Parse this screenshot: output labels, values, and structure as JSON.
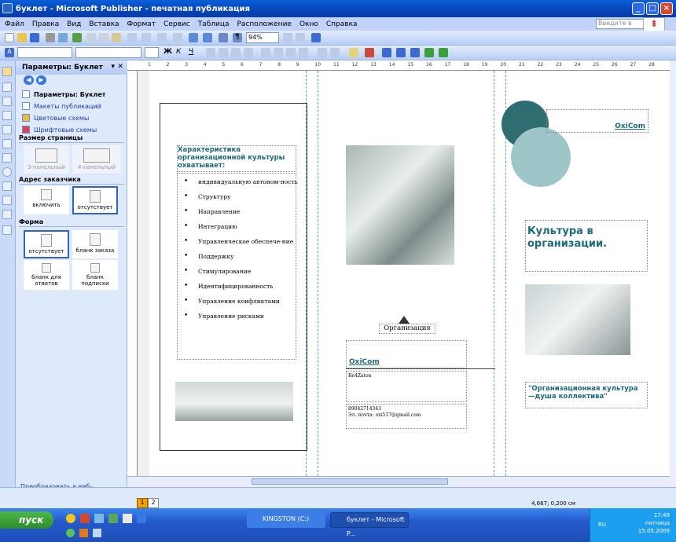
{
  "window": {
    "title": "буклет - Microsoft Publisher - печатная публикация"
  },
  "menu": [
    "Файл",
    "Правка",
    "Вид",
    "Вставка",
    "Формат",
    "Сервис",
    "Таблица",
    "Расположение",
    "Окно",
    "Справка"
  ],
  "help_placeholder": "Введите в",
  "toolbar": {
    "zoom": "94%"
  },
  "pane": {
    "title": "Параметры: Буклет",
    "links": [
      "Параметры: Буклет",
      "Макеты публикаций",
      "Цветовые схемы",
      "Шрифтовые схемы"
    ],
    "page_size_label": "Размер страницы",
    "page_sizes": [
      "3-панельный",
      "4-панельный"
    ],
    "address_label": "Адрес заказчика",
    "address_opts": [
      "включить",
      "отсутствует"
    ],
    "form_label": "Форма",
    "form_opts": [
      "отсутствует",
      "бланк заказа",
      "бланк для ответов",
      "бланк подписки"
    ],
    "convert_link": "Преобразовать в веб-публикацию..."
  },
  "ruler": [
    "1",
    "2",
    "3",
    "4",
    "5",
    "6",
    "7",
    "8",
    "9",
    "10",
    "11",
    "12",
    "13",
    "14",
    "15",
    "16",
    "17",
    "18",
    "19",
    "20",
    "21",
    "22",
    "23",
    "24",
    "25",
    "26",
    "27",
    "28"
  ],
  "panel1": {
    "heading": "Характеристика организационной культуры охватывает:",
    "items": [
      "индивидуальную автоном-ность",
      "Структуру",
      "Направление",
      "Интеграцию",
      "Управленческое обеспече-ние",
      "Поддержку",
      "Стимулирование",
      "Идентифицированность",
      "Управление конфликтами",
      "Управление рисками"
    ]
  },
  "panel2": {
    "org_label": "Организация",
    "company": "OxiCom",
    "address": "Re4Zaton",
    "phone": "89042714343",
    "email": "Эл. почта: oxi517@gmail.com"
  },
  "panel3": {
    "company": "OxiCom",
    "title": "Культура в организации.",
    "slogan": "\"Организационная культура—душа коллектива\""
  },
  "status": {
    "pages": [
      "1",
      "2"
    ],
    "coords": "4,667; 0,200 см"
  },
  "taskbar": {
    "start": "пуск",
    "tasks": [
      "KINGSTON (C:)",
      "буклет - Microsoft P..."
    ],
    "lang": "RU",
    "time": "17:49",
    "day": "пятница",
    "date": "15.05.2009"
  }
}
